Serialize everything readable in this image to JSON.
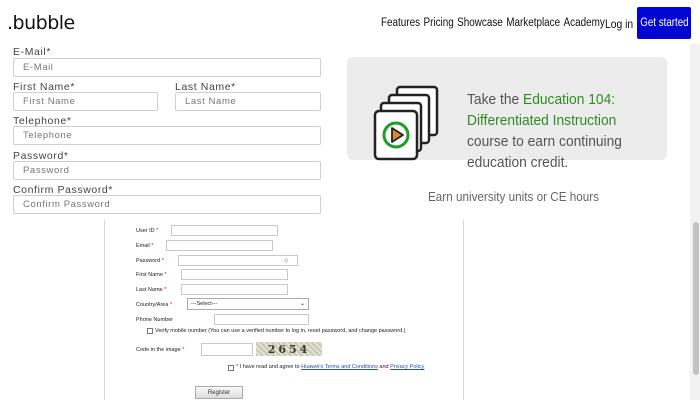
{
  "header": {
    "logo": ".bubble",
    "nav": [
      "Features",
      "Pricing",
      "Showcase",
      "Marketplace",
      "Academy"
    ],
    "login": "Log in",
    "cta": "Get started",
    "cta_color": "#0205d4"
  },
  "form": {
    "email": {
      "label": "E-Mail*",
      "placeholder": "E-Mail"
    },
    "first_name": {
      "label": "First Name*",
      "placeholder": "First Name"
    },
    "last_name": {
      "label": "Last Name*",
      "placeholder": "Last Name"
    },
    "telephone": {
      "label": "Telephone*",
      "placeholder": "Telephone"
    },
    "password": {
      "label": "Password*",
      "placeholder": "Password"
    },
    "confirm_password": {
      "label": "Confirm Password*",
      "placeholder": "Confirm Password"
    }
  },
  "promo": {
    "text_before": "Take the ",
    "highlight": "Education 104: Differentiated Instruction",
    "text_after": " course to earn continuing education credit.",
    "highlight_color": "#2e8b22",
    "icon": "video-play-stack-icon",
    "earn": "Earn university units or CE hours"
  },
  "embedded_form": {
    "user_id": "User ID",
    "email": "Email",
    "password": "Password",
    "first_name": "First Name",
    "last_name": "Last Name",
    "country": "Country/Area",
    "country_selected": "---Select---",
    "phone": "Phone Number",
    "verify": "Verify mobile number (You can use a verified number to log in, reset password, and change password.)",
    "code_label": "Code in the image",
    "captcha": "2654",
    "agree_prefix": "I have read and agree to ",
    "agree_link1": "Huawei's Terms and Conditions",
    "agree_mid": " and ",
    "agree_link2": "Privacy Policy",
    "register": "Register",
    "required_mark": "*"
  }
}
